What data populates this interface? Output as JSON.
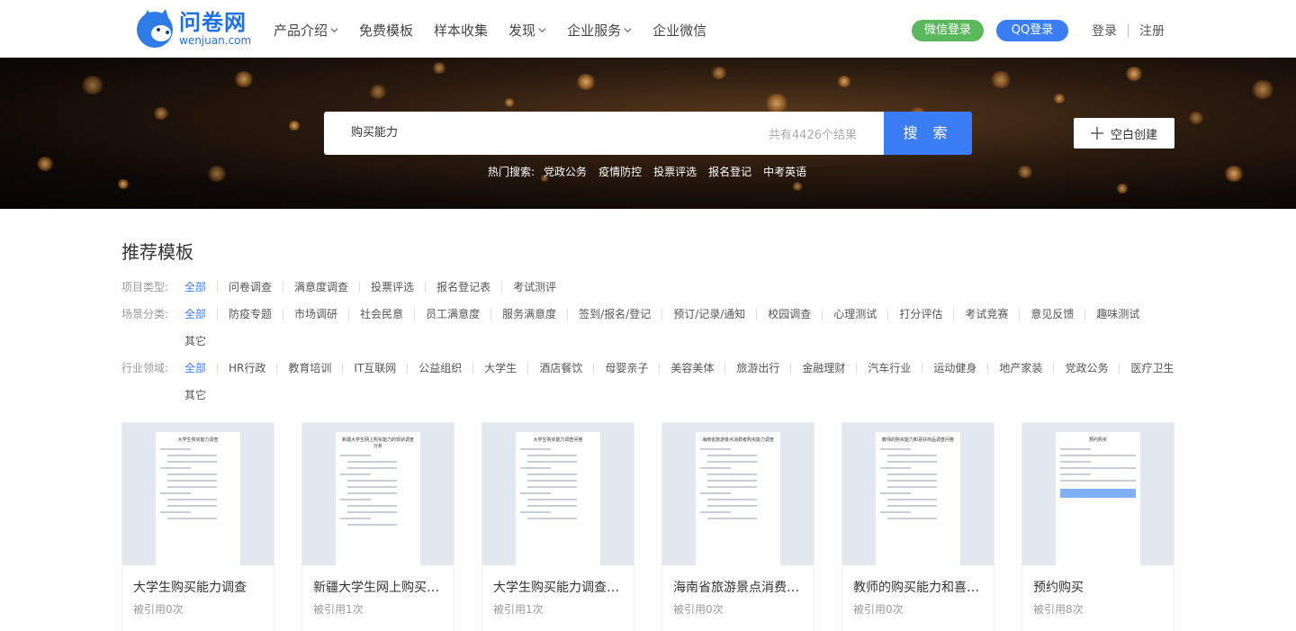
{
  "header": {
    "logo_cn": "问卷网",
    "logo_en": "wenjuan.com",
    "nav": [
      {
        "label": "产品介绍",
        "dropdown": true
      },
      {
        "label": "免费模板",
        "dropdown": false
      },
      {
        "label": "样本收集",
        "dropdown": false
      },
      {
        "label": "发现",
        "dropdown": true
      },
      {
        "label": "企业服务",
        "dropdown": true
      },
      {
        "label": "企业微信",
        "dropdown": false
      }
    ],
    "wechat_login": "微信登录",
    "qq_login": "QQ登录",
    "login": "登录",
    "register": "注册",
    "colors": {
      "wechat": "#5cb85c",
      "qq": "#3b7df5",
      "brand": "#1f6fe5"
    }
  },
  "search": {
    "value": "购买能力",
    "result_count": "共有4426个结果",
    "button": "搜 索",
    "create_button": "空白创建",
    "hot_label": "热门搜索:",
    "hot_items": [
      "党政公务",
      "疫情防控",
      "投票评选",
      "报名登记",
      "中考英语"
    ]
  },
  "section": {
    "title": "推荐模板",
    "filters": [
      {
        "label": "项目类型:",
        "items": [
          "全部",
          "问卷调查",
          "满意度调查",
          "投票评选",
          "报名登记表",
          "考试测评"
        ]
      },
      {
        "label": "场景分类:",
        "items": [
          "全部",
          "防疫专题",
          "市场调研",
          "社会民意",
          "员工满意度",
          "服务满意度",
          "签到/报名/登记",
          "预订/记录/通知",
          "校园调查",
          "心理测试",
          "打分评估",
          "考试竞赛",
          "意见反馈",
          "趣味测试",
          "其它"
        ]
      },
      {
        "label": "行业领域:",
        "items": [
          "全部",
          "HR行政",
          "教育培训",
          "IT互联网",
          "公益组织",
          "大学生",
          "酒店餐饮",
          "母婴亲子",
          "美容美体",
          "旅游出行",
          "金融理财",
          "汽车行业",
          "运动健身",
          "地产家装",
          "党政公务",
          "医疗卫生",
          "其它"
        ]
      }
    ],
    "active_color": "#3b7df5"
  },
  "cards": [
    {
      "name": "大学生购买能力调查",
      "refs": "被引用0次",
      "paper_title": "大学生购买能力调查"
    },
    {
      "name": "新疆大学生网上购买能力的现状调查分析",
      "refs": "被引用1次",
      "paper_title": "新疆大学生网上购买能力的现状调查分析"
    },
    {
      "name": "大学生购买能力调查问卷",
      "refs": "被引用1次",
      "paper_title": "大学生购买能力调查问卷"
    },
    {
      "name": "海南省旅游景点消费者购买能力调查",
      "refs": "被引用0次",
      "paper_title": "海南省旅游景点消费者购买能力调查"
    },
    {
      "name": "教师的购买能力和喜好商品调查问卷",
      "refs": "被引用0次",
      "paper_title": "教师的购买能力和喜好商品调查问卷"
    },
    {
      "name": "预约购买",
      "refs": "被引用8次",
      "paper_title": "预约购买"
    }
  ]
}
